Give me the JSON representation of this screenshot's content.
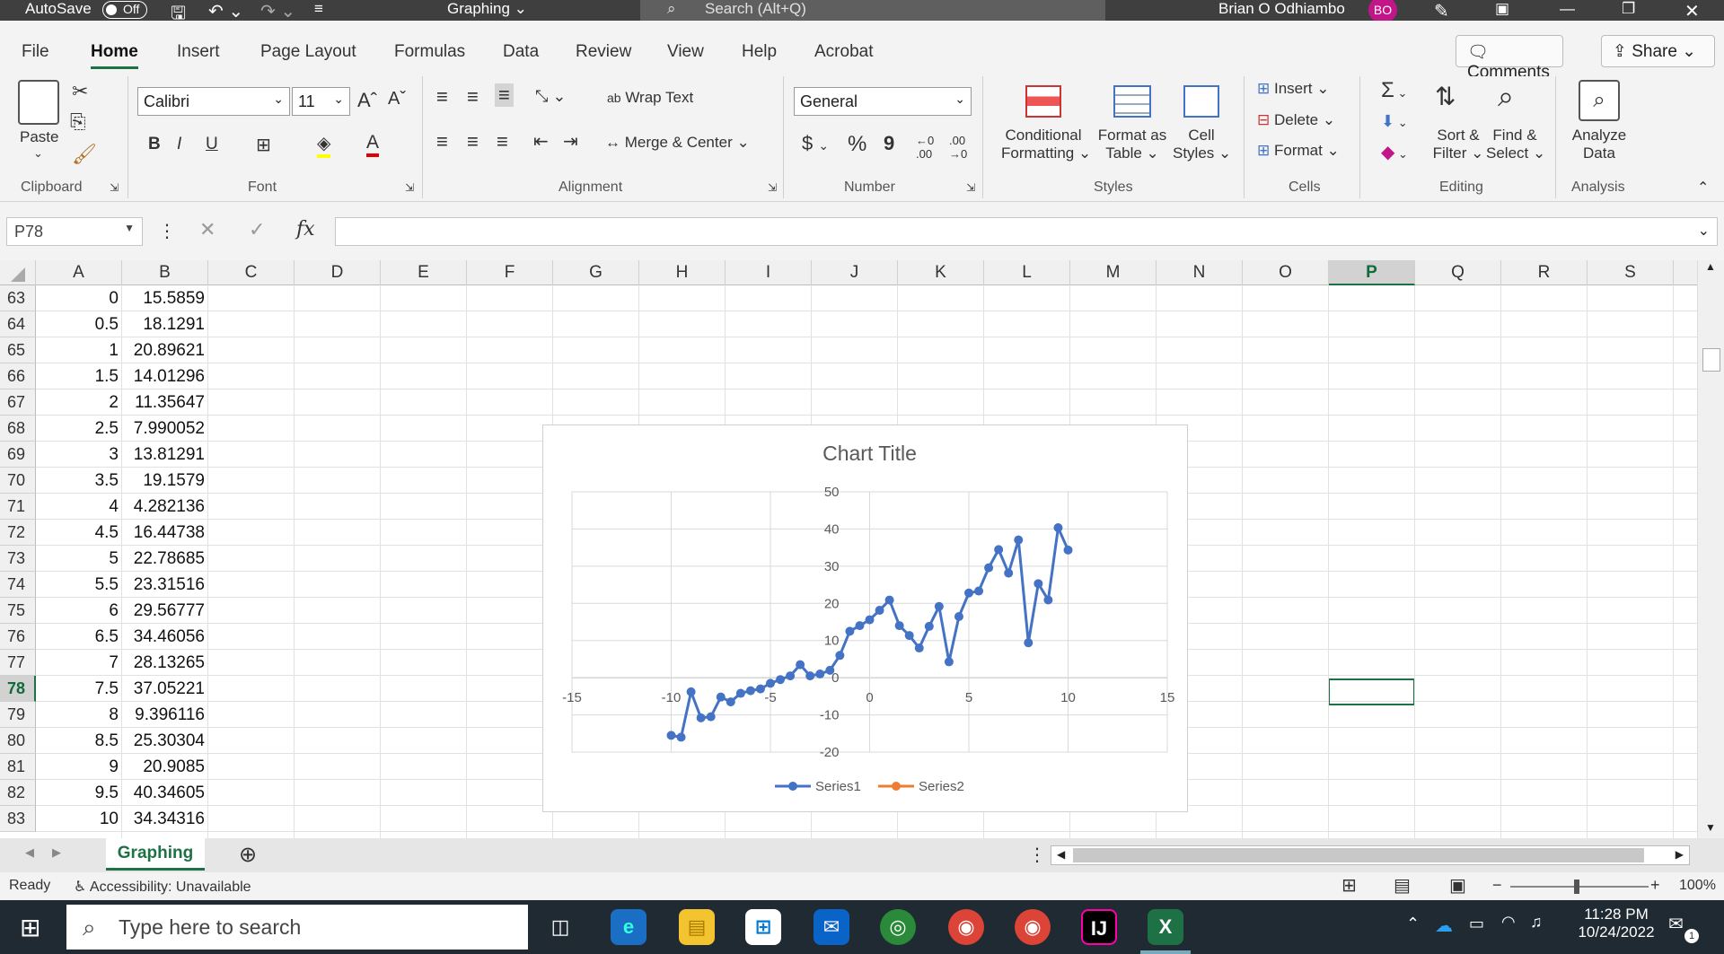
{
  "titlebar": {
    "autosave_label": "AutoSave",
    "autosave_state": "Off",
    "doc_title": "Graphing",
    "search_placeholder": "Search (Alt+Q)",
    "user_name": "Brian O Odhiambo",
    "user_initials": "BO"
  },
  "menu": {
    "tabs": [
      "File",
      "Home",
      "Insert",
      "Page Layout",
      "Formulas",
      "Data",
      "Review",
      "View",
      "Help",
      "Acrobat"
    ],
    "active_tab": "Home",
    "comments_label": "Comments",
    "share_label": "Share"
  },
  "ribbon": {
    "clipboard": {
      "paste": "Paste",
      "group": "Clipboard"
    },
    "font": {
      "name": "Calibri",
      "size": "11",
      "bold": "B",
      "italic": "I",
      "underline": "U",
      "group": "Font"
    },
    "alignment": {
      "wrap": "Wrap Text",
      "merge": "Merge & Center",
      "group": "Alignment"
    },
    "number": {
      "format": "General",
      "currency": "$",
      "percent": "%",
      "comma": "9",
      "group": "Number"
    },
    "styles": {
      "conditional_1": "Conditional",
      "conditional_2": "Formatting",
      "format_table_1": "Format as",
      "format_table_2": "Table",
      "cell_styles_1": "Cell",
      "cell_styles_2": "Styles",
      "group": "Styles"
    },
    "cells": {
      "insert": "Insert",
      "delete": "Delete",
      "format": "Format",
      "group": "Cells"
    },
    "editing": {
      "sort_1": "Sort &",
      "sort_2": "Filter",
      "find_1": "Find &",
      "find_2": "Select",
      "group": "Editing"
    },
    "analysis": {
      "analyze_1": "Analyze",
      "analyze_2": "Data",
      "group": "Analysis"
    }
  },
  "formula_bar": {
    "name_box": "P78",
    "fx": "fx",
    "value": ""
  },
  "columns": [
    "A",
    "B",
    "C",
    "D",
    "E",
    "F",
    "G",
    "H",
    "I",
    "J",
    "K",
    "L",
    "M",
    "N",
    "O",
    "P",
    "Q",
    "R",
    "S"
  ],
  "selected_column": "P",
  "selected_row": "78",
  "rows": [
    {
      "num": "63",
      "a": "0",
      "b": "15.5859"
    },
    {
      "num": "64",
      "a": "0.5",
      "b": "18.1291"
    },
    {
      "num": "65",
      "a": "1",
      "b": "20.89621"
    },
    {
      "num": "66",
      "a": "1.5",
      "b": "14.01296"
    },
    {
      "num": "67",
      "a": "2",
      "b": "11.35647"
    },
    {
      "num": "68",
      "a": "2.5",
      "b": "7.990052"
    },
    {
      "num": "69",
      "a": "3",
      "b": "13.81291"
    },
    {
      "num": "70",
      "a": "3.5",
      "b": "19.1579"
    },
    {
      "num": "71",
      "a": "4",
      "b": "4.282136"
    },
    {
      "num": "72",
      "a": "4.5",
      "b": "16.44738"
    },
    {
      "num": "73",
      "a": "5",
      "b": "22.78685"
    },
    {
      "num": "74",
      "a": "5.5",
      "b": "23.31516"
    },
    {
      "num": "75",
      "a": "6",
      "b": "29.56777"
    },
    {
      "num": "76",
      "a": "6.5",
      "b": "34.46056"
    },
    {
      "num": "77",
      "a": "7",
      "b": "28.13265"
    },
    {
      "num": "78",
      "a": "7.5",
      "b": "37.05221"
    },
    {
      "num": "79",
      "a": "8",
      "b": "9.396116"
    },
    {
      "num": "80",
      "a": "8.5",
      "b": "25.30304"
    },
    {
      "num": "81",
      "a": "9",
      "b": "20.9085"
    },
    {
      "num": "82",
      "a": "9.5",
      "b": "40.34605"
    },
    {
      "num": "83",
      "a": "10",
      "b": "34.34316"
    }
  ],
  "chart_data": {
    "type": "scatter",
    "title": "Chart Title",
    "xlim": [
      -15,
      15
    ],
    "ylim": [
      -20,
      50
    ],
    "x_ticks": [
      "-15",
      "-10",
      "-5",
      "0",
      "5",
      "10",
      "15"
    ],
    "y_ticks": [
      "50",
      "40",
      "30",
      "20",
      "10",
      "0",
      "-10",
      "-20"
    ],
    "grid": true,
    "legend_position": "bottom",
    "series": [
      {
        "name": "Series1",
        "color": "#4472c4",
        "x": [
          -10,
          -9.5,
          -9,
          -8.5,
          -8,
          -7.5,
          -7,
          -6.5,
          -6,
          -5.5,
          -5,
          -4.5,
          -4,
          -3.5,
          -3,
          -2.5,
          -2,
          -1.5,
          -1,
          -0.5,
          0,
          0.5,
          1,
          1.5,
          2,
          2.5,
          3,
          3.5,
          4,
          4.5,
          5,
          5.5,
          6,
          6.5,
          7,
          7.5,
          8,
          8.5,
          9,
          9.5,
          10
        ],
        "y": [
          -15.5,
          -16,
          -3.8,
          -10.8,
          -10.5,
          -5.2,
          -6.5,
          -4.2,
          -3.5,
          -3,
          -1.5,
          -0.5,
          0.5,
          3.5,
          0.5,
          1,
          2,
          6,
          12.5,
          14,
          15.5859,
          18.1291,
          20.89621,
          14.01296,
          11.35647,
          7.990052,
          13.81291,
          19.1579,
          4.282136,
          16.44738,
          22.78685,
          23.31516,
          29.56777,
          34.46056,
          28.13265,
          37.05221,
          9.396116,
          25.30304,
          20.9085,
          40.34605,
          34.34316
        ]
      },
      {
        "name": "Series2",
        "color": "#ed7d31",
        "x": [],
        "y": []
      }
    ]
  },
  "sheets": {
    "active": "Graphing"
  },
  "status": {
    "ready": "Ready",
    "accessibility": "Accessibility: Unavailable",
    "zoom": "100%"
  },
  "taskbar": {
    "search_placeholder": "Type here to search",
    "time": "11:28 PM",
    "date": "10/24/2022",
    "notifications": "1"
  }
}
